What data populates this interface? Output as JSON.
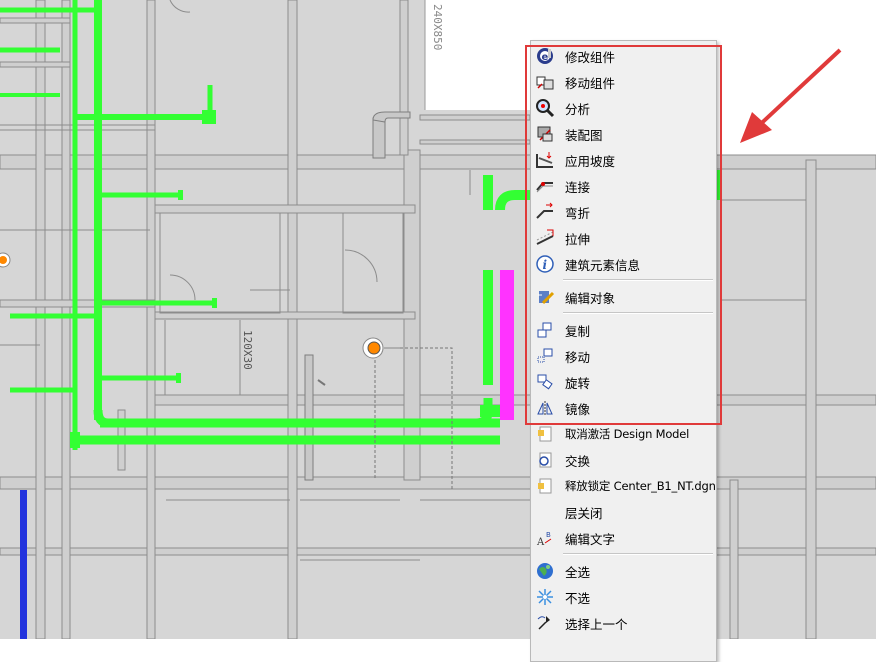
{
  "drawing": {
    "dimension_labels": [
      "240X850",
      "120X30"
    ],
    "colors": {
      "background": "#d6d6d6",
      "pipe_green": "#33ff33",
      "pipe_magenta": "#ff33ff",
      "pipe_blue": "#2233dd",
      "annotation_red": "#e03a3a"
    }
  },
  "context_menu": {
    "groups": [
      [
        {
          "label": "修改组件",
          "icon": "modify-component-icon"
        },
        {
          "label": "移动组件",
          "icon": "move-component-icon"
        },
        {
          "label": "分析",
          "icon": "analyze-magnifier-icon"
        },
        {
          "label": "装配图",
          "icon": "assembly-drawing-icon"
        },
        {
          "label": "应用坡度",
          "icon": "apply-slope-icon"
        },
        {
          "label": "连接",
          "icon": "connect-icon"
        },
        {
          "label": "弯折",
          "icon": "bend-icon"
        },
        {
          "label": "拉伸",
          "icon": "stretch-icon"
        },
        {
          "label": "建筑元素信息",
          "icon": "info-icon"
        }
      ],
      [
        {
          "label": "编辑对象",
          "icon": "edit-object-icon"
        }
      ],
      [
        {
          "label": "复制",
          "icon": "copy-icon"
        },
        {
          "label": "移动",
          "icon": "move-icon"
        },
        {
          "label": "旋转",
          "icon": "rotate-icon"
        },
        {
          "label": "镜像",
          "icon": "mirror-icon"
        },
        {
          "label": "取消激活 Design Model",
          "icon": "deactivate-model-icon"
        },
        {
          "label": "交换",
          "icon": "exchange-icon"
        },
        {
          "label": "释放锁定 Center_B1_NT.dgn",
          "icon": "release-lock-icon"
        },
        {
          "label": "层关闭",
          "icon": ""
        },
        {
          "label": "编辑文字",
          "icon": "edit-text-icon"
        }
      ],
      [
        {
          "label": "全选",
          "icon": "select-all-globe-icon"
        },
        {
          "label": "不选",
          "icon": "deselect-sparkle-icon"
        },
        {
          "label": "选择上一个",
          "icon": "select-previous-icon"
        }
      ]
    ]
  }
}
